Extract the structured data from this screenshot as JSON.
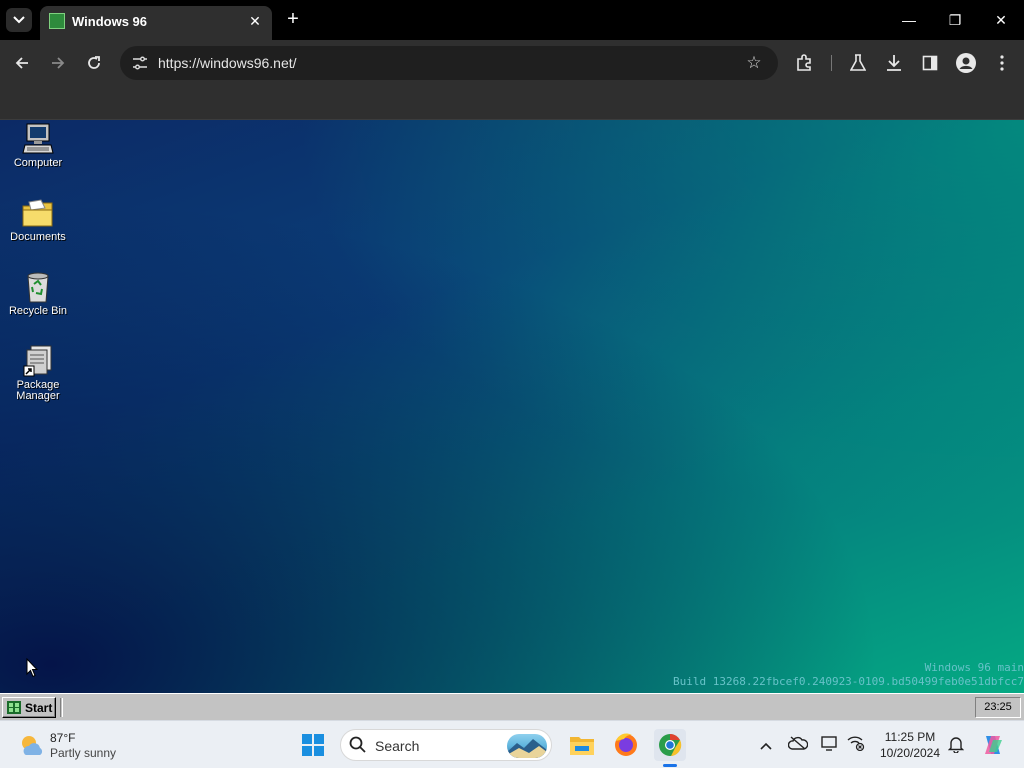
{
  "browser": {
    "tab_title": "Windows 96",
    "tab_close": "✕",
    "new_tab": "+",
    "url": "https://windows96.net/",
    "window_controls": {
      "minimize": "—",
      "restore": "❐",
      "close": "✕"
    }
  },
  "desktop": {
    "icons": [
      {
        "label": "Computer",
        "icon": "computer-icon"
      },
      {
        "label": "Documents",
        "icon": "folder-icon"
      },
      {
        "label": "Recycle Bin",
        "icon": "recycle-bin-icon"
      },
      {
        "label": "Package Manager",
        "icon": "package-manager-icon"
      }
    ],
    "build_line1": "Windows 96 main",
    "build_line2": "Build 13268.22fbcef0.240923-0109.bd50499feb0e51dbfcc7"
  },
  "w96_taskbar": {
    "start_label": "Start",
    "clock": "23:25"
  },
  "win11_taskbar": {
    "weather_temp": "87°F",
    "weather_condition": "Partly sunny",
    "search_placeholder": "Search",
    "time": "11:25 PM",
    "date": "10/20/2024",
    "pinned_apps": [
      "file-explorer-icon",
      "firefox-icon",
      "chrome-icon"
    ],
    "tray_icons": [
      "chevron-up-icon",
      "onedrive-icon",
      "display-icon",
      "network-icon",
      "notification-icon",
      "copilot-icon"
    ]
  },
  "colors": {
    "desktop_gradient_start": "#0c2a66",
    "desktop_gradient_end": "#05a983",
    "browser_chrome": "#2f2f2f",
    "w96_taskbar": "#c3c3c3",
    "win11_taskbar": "#ebeff4"
  }
}
